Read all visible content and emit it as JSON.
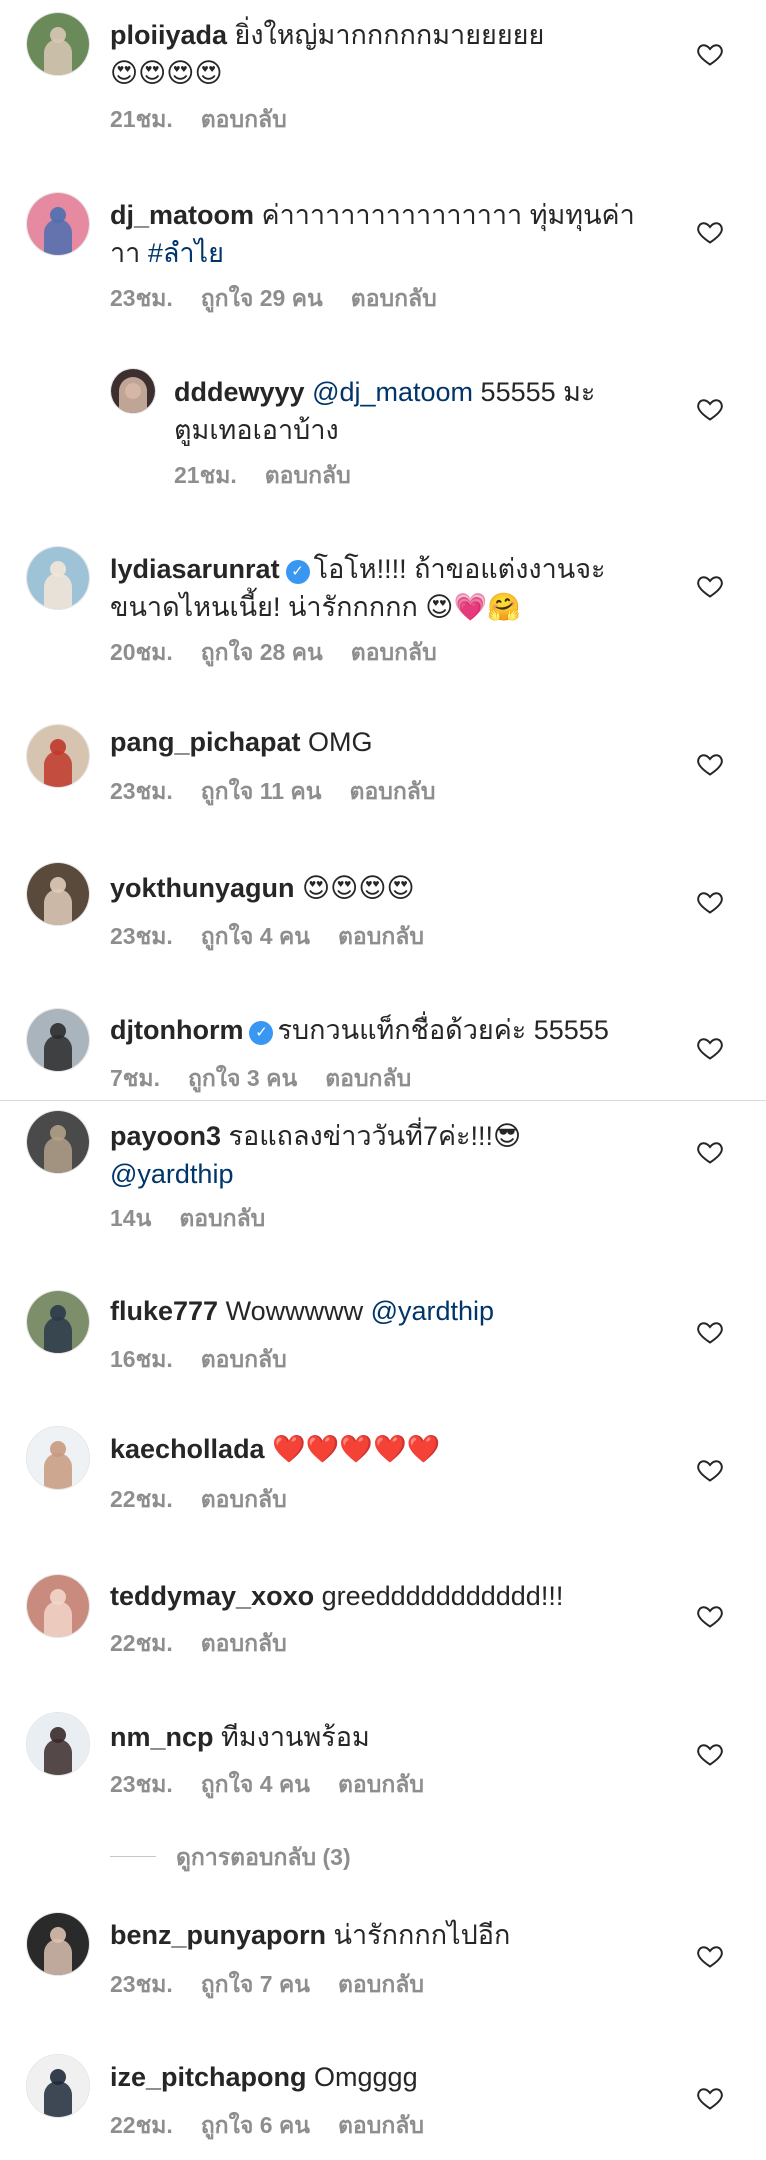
{
  "comments": [
    {
      "username": "ploiiyada",
      "verified": false,
      "lines": [
        "ยิ่งใหญ่มากกกกกมายยยยย",
        "😍😍😍😍"
      ],
      "meta": [
        "21ชม.",
        "ตอบกลับ"
      ],
      "avatar_colors": [
        "#6b8a5a",
        "#d9c7b5"
      ]
    },
    {
      "username": "dj_matoom",
      "verified": false,
      "lines": [
        "ค่าาาาาาาาาาาาาาาา ทุ่มทุนค่า",
        "าา #ลำไย"
      ],
      "meta": [
        "23ชม.",
        "ถูกใจ 29 คน",
        "ตอบกลับ"
      ],
      "avatar_colors": [
        "#e58aa0",
        "#4d6fb0"
      ]
    },
    {
      "username": "dddewyyy",
      "verified": false,
      "lines": [
        "@dj_matoom 55555 มะ",
        "ตูมเทอเอาบ้าง"
      ],
      "meta": [
        "21ชม.",
        "ตอบกลับ"
      ],
      "avatar_colors": [
        "#3b2f2f",
        "#d8b8a8"
      ]
    },
    {
      "username": "lydiasarunrat",
      "verified": true,
      "lines": [
        "โอโห!!!! ถ้าขอแต่งงานจะ",
        "ขนาดไหนเนี้ย! น่ารักกกกก 😍💗🤗"
      ],
      "meta": [
        "20ชม.",
        "ถูกใจ 28 คน",
        "ตอบกลับ"
      ],
      "avatar_colors": [
        "#9fc3d6",
        "#f3e6d8"
      ]
    },
    {
      "username": "pang_pichapat",
      "verified": false,
      "lines": [
        "OMG"
      ],
      "meta": [
        "23ชม.",
        "ถูกใจ 11 คน",
        "ตอบกลับ"
      ],
      "avatar_colors": [
        "#d7c4b0",
        "#c0392b"
      ]
    },
    {
      "username": "yokthunyagun",
      "verified": false,
      "lines": [
        "😍😍😍😍"
      ],
      "meta": [
        "23ชม.",
        "ถูกใจ 4 คน",
        "ตอบกลับ"
      ],
      "avatar_colors": [
        "#5a4a3c",
        "#e0cbb8"
      ]
    },
    {
      "username": "djtonhorm",
      "verified": true,
      "lines": [
        "รบกวนแท็กชื่อด้วยค่ะ 55555"
      ],
      "meta": [
        "7ชม.",
        "ถูกใจ 3 คน",
        "ตอบกลับ"
      ],
      "avatar_colors": [
        "#aab4bc",
        "#2c2c2c"
      ]
    },
    {
      "username": "payoon3",
      "verified": false,
      "lines": [
        "รอแถลงข่าววันที่7ค่ะ!!!😎",
        "@yardthip"
      ],
      "meta": [
        "14น",
        "ตอบกลับ"
      ],
      "avatar_colors": [
        "#4a4a4a",
        "#b0a08a"
      ]
    },
    {
      "username": "fluke777",
      "verified": false,
      "lines": [
        "Wowwwww @yardthip"
      ],
      "meta": [
        "16ชม.",
        "ตอบกลับ"
      ],
      "avatar_colors": [
        "#7d8f6a",
        "#2b3a4a"
      ]
    },
    {
      "username": "kaechollada",
      "verified": false,
      "lines": [
        "❤️❤️❤️❤️❤️"
      ],
      "meta": [
        "22ชม.",
        "ตอบกลับ"
      ],
      "avatar_colors": [
        "#eef2f5",
        "#c89a7e"
      ]
    },
    {
      "username": "teddymay_xoxo",
      "verified": false,
      "lines": [
        "greeddddddddddd!!!"
      ],
      "meta": [
        "22ชม.",
        "ตอบกลับ"
      ],
      "avatar_colors": [
        "#c98b7e",
        "#f2d6c9"
      ]
    },
    {
      "username": "nm_ncp",
      "verified": false,
      "lines": [
        "ทีมงานพร้อม"
      ],
      "meta": [
        "23ชม.",
        "ถูกใจ 4 คน",
        "ตอบกลับ"
      ],
      "avatar_colors": [
        "#e9eef2",
        "#3a2a2a"
      ]
    },
    {
      "username": "benz_punyaporn",
      "verified": false,
      "lines": [
        "น่ารักกกกไปอีก"
      ],
      "meta": [
        "23ชม.",
        "ถูกใจ 7 คน",
        "ตอบกลับ"
      ],
      "avatar_colors": [
        "#2a2a2a",
        "#d9c0b0"
      ]
    },
    {
      "username": "ize_pitchapong",
      "verified": false,
      "lines": [
        "Omgggg"
      ],
      "meta": [
        "22ชม.",
        "ถูกใจ 6 คน",
        "ตอบกลับ"
      ],
      "avatar_colors": [
        "#f0f0f0",
        "#1f2a3a"
      ]
    }
  ],
  "view_replies_label": "ดูการตอบกลับ (3)",
  "colors": {
    "text": "#262626",
    "meta": "#8e8e8e",
    "mention": "#003569",
    "verified": "#3897f0"
  }
}
